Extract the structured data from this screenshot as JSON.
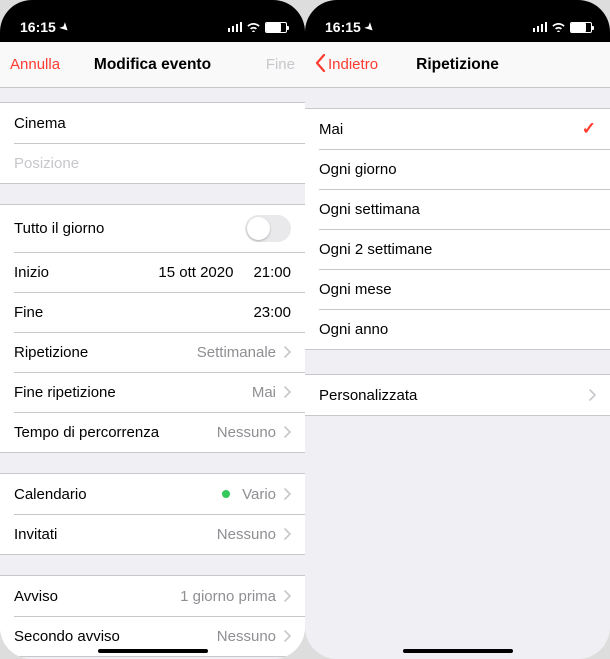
{
  "status": {
    "time": "16:15"
  },
  "left": {
    "nav": {
      "cancel": "Annulla",
      "title": "Modifica evento",
      "done": "Fine"
    },
    "event": {
      "title_value": "Cinema",
      "location_placeholder": "Posizione"
    },
    "allday": {
      "label": "Tutto il giorno"
    },
    "start": {
      "label": "Inizio",
      "date": "15 ott 2020",
      "time": "21:00"
    },
    "end": {
      "label": "Fine",
      "time": "23:00"
    },
    "repeat": {
      "label": "Ripetizione",
      "value": "Settimanale"
    },
    "repeatEnd": {
      "label": "Fine ripetizione",
      "value": "Mai"
    },
    "travel": {
      "label": "Tempo di percorrenza",
      "value": "Nessuno"
    },
    "calendar": {
      "label": "Calendario",
      "value": "Vario"
    },
    "invitees": {
      "label": "Invitati",
      "value": "Nessuno"
    },
    "alert1": {
      "label": "Avviso",
      "value": "1 giorno prima"
    },
    "alert2": {
      "label": "Secondo avviso",
      "value": "Nessuno"
    }
  },
  "right": {
    "nav": {
      "back": "Indietro",
      "title": "Ripetizione"
    },
    "options": {
      "o0": "Mai",
      "o1": "Ogni giorno",
      "o2": "Ogni settimana",
      "o3": "Ogni 2 settimane",
      "o4": "Ogni mese",
      "o5": "Ogni anno"
    },
    "custom": "Personalizzata"
  }
}
